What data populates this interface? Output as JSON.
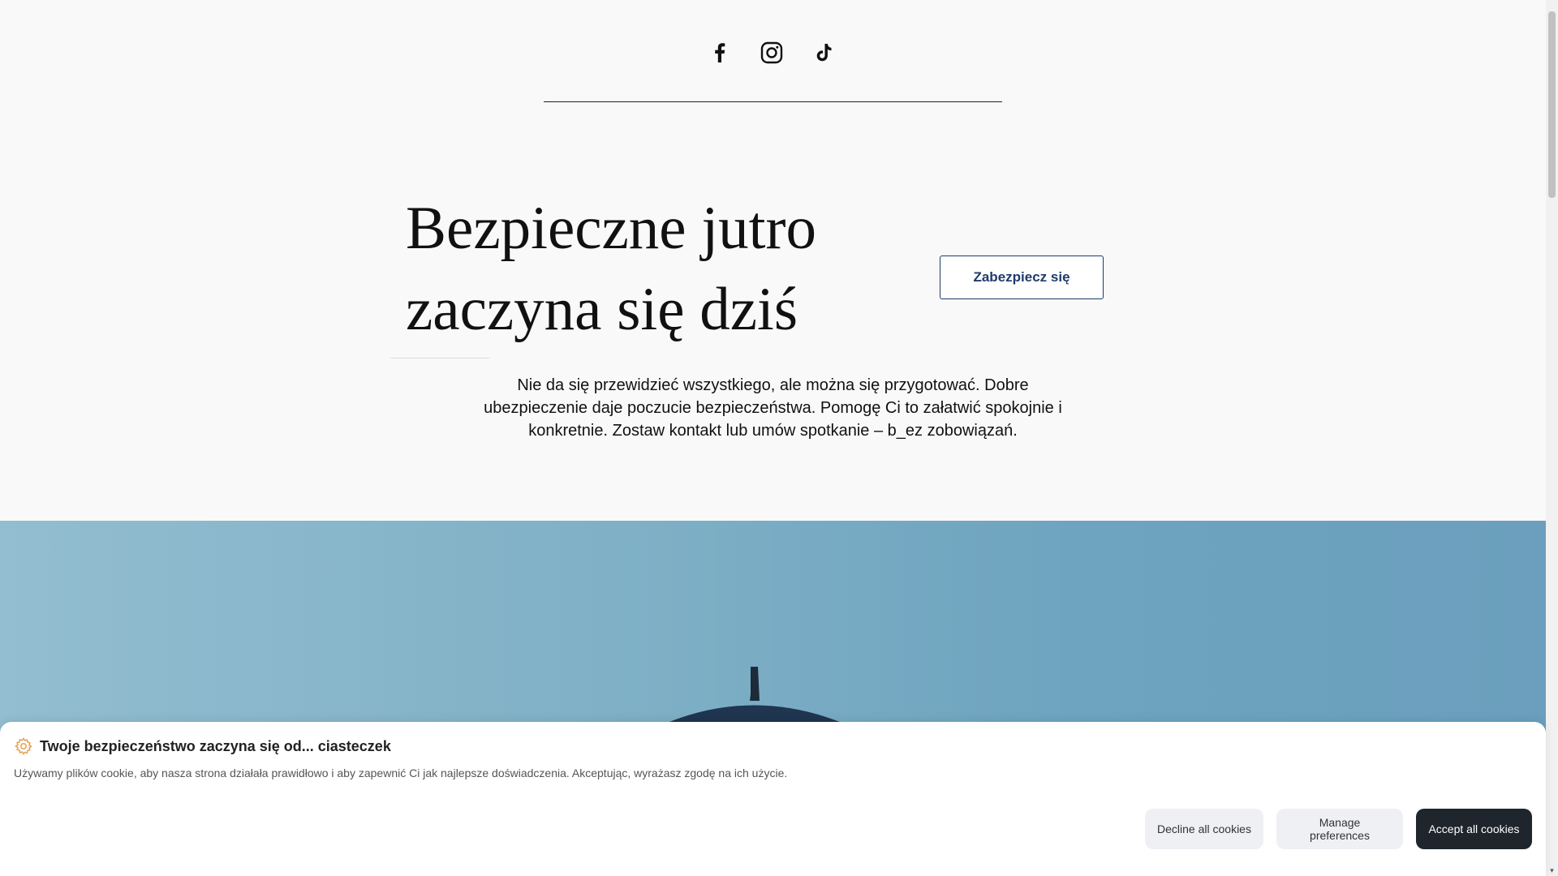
{
  "social": {
    "icons": [
      "facebook-icon",
      "instagram-icon",
      "tiktok-icon"
    ]
  },
  "hero": {
    "title_line1": "Bezpieczne jutro",
    "title_line2": "zaczyna się dziś",
    "cta_label": "Zabezpiecz się",
    "lead": "Nie da się przewidzieć wszystkiego, ale można się przygotować. Dobre ubezpieczenie daje poczucie bezpieczeństwa. Pomogę Ci to załatwić spokojnie i konkretnie. Zostaw kontakt lub umów spotkanie – b_ez zobowiązań."
  },
  "cookie": {
    "icon": "gear-icon",
    "title": "Twoje bezpieczeństwo zaczyna się od... ciasteczek",
    "text": "Używamy plików cookie, aby nasza strona działała prawidłowo i aby zapewnić Ci jak najlepsze doświadczenia. Akceptując, wyrażasz zgodę na ich użycie.",
    "decline_label": "Decline all cookies",
    "manage_label": "Manage preferences",
    "accept_label": "Accept all cookies"
  },
  "colors": {
    "accent": "#1f3b6b",
    "sky": "#7fb0c6",
    "dark_button": "#1e252c"
  }
}
